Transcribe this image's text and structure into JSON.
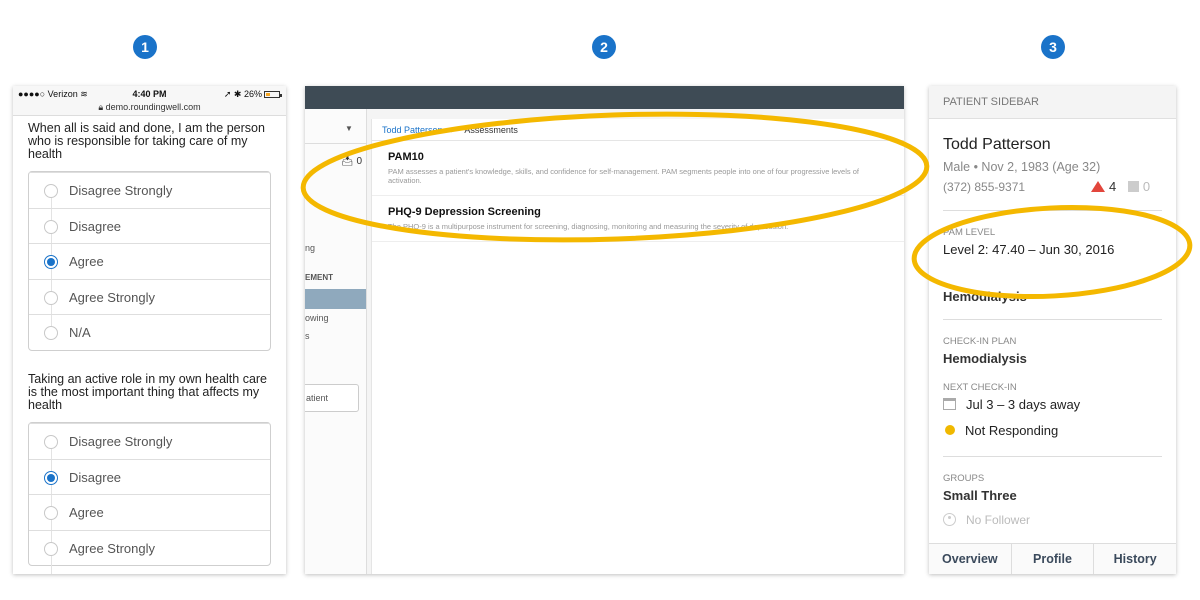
{
  "steps": [
    "1",
    "2",
    "3"
  ],
  "colors": {
    "accent": "#1a73c9",
    "highlight": "#f4b800",
    "alert": "#e2463c"
  },
  "phone": {
    "carrier": "●●●●○ Verizon",
    "time": "4:40 PM",
    "battery": "26%",
    "url": "demo.roundingwell.com",
    "questions": [
      {
        "text": "When all is said and done, I am the person who is responsible for taking care of my health",
        "options": [
          "Disagree Strongly",
          "Disagree",
          "Agree",
          "Agree Strongly",
          "N/A"
        ],
        "selected": "Agree"
      },
      {
        "text": "Taking an active role in my own health care is the most important thing that affects my health",
        "options": [
          "Disagree Strongly",
          "Disagree",
          "Agree",
          "Agree Strongly"
        ],
        "selected": "Disagree"
      }
    ]
  },
  "desktop": {
    "inbox_count": "0",
    "nav_fragments": [
      "ng",
      "EMENT",
      "owing",
      "s"
    ],
    "add_button": "atient",
    "breadcrumb": {
      "patient": "Todd Patterson",
      "separator": ">",
      "current": "Assessments"
    },
    "assessments": [
      {
        "title": "PAM10",
        "description": "PAM assesses a patient's knowledge, skills, and confidence for self-management. PAM segments people into one of four progressive levels of activation."
      },
      {
        "title": "PHQ-9 Depression Screening",
        "description": "The PHQ-9 is a multipurpose instrument for screening, diagnosing, monitoring and measuring the severity of depression."
      }
    ]
  },
  "sidebar": {
    "header": "PATIENT SIDEBAR",
    "name": "Todd Patterson",
    "meta": "Male • Nov 2, 1983 (Age 32)",
    "phone": "(372) 855-9371",
    "alerts": "4",
    "tasks": "0",
    "pam_label": "PAM LEVEL",
    "pam_value": "Level 2: 47.40 – Jun 30, 2016",
    "program": "Hemodialysis",
    "checkin_plan_label": "CHECK-IN PLAN",
    "checkin_plan": "Hemodialysis",
    "next_checkin_label": "NEXT CHECK-IN",
    "next_checkin": "Jul 3 – 3 days away",
    "status": "Not Responding",
    "groups_label": "GROUPS",
    "group": "Small Three",
    "follower": "No Follower",
    "tabs": [
      "Overview",
      "Profile",
      "History"
    ]
  }
}
